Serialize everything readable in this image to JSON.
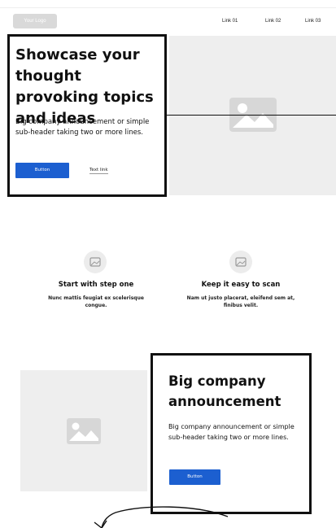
{
  "nav": {
    "logo": "Your Logo",
    "links": [
      "Link 01",
      "Link 02",
      "Link 03"
    ]
  },
  "hero": {
    "title": "Showcase your thought provoking topics and ideas",
    "subheader": "Big company announcement or simple sub-header taking two or more lines.",
    "button_label": "Button",
    "text_link": "Text link"
  },
  "features": [
    {
      "title": "Start with step one",
      "description": "Nunc mattis feugiat ex scelerisque congue."
    },
    {
      "title": "Keep it easy to scan",
      "description": "Nam ut justo placerat, eleifend sem at, finibus velit."
    }
  ],
  "announcement": {
    "title": "Big company announcement",
    "subheader": "Big company announcement or simple sub-header taking two or more lines.",
    "button_label": "Button"
  },
  "icons": [
    "image-placeholder-icon",
    "curved-arrow-icon"
  ],
  "colors": {
    "button": "#1c5fd0",
    "placeholder": "#eeeeee",
    "border": "#111111"
  }
}
